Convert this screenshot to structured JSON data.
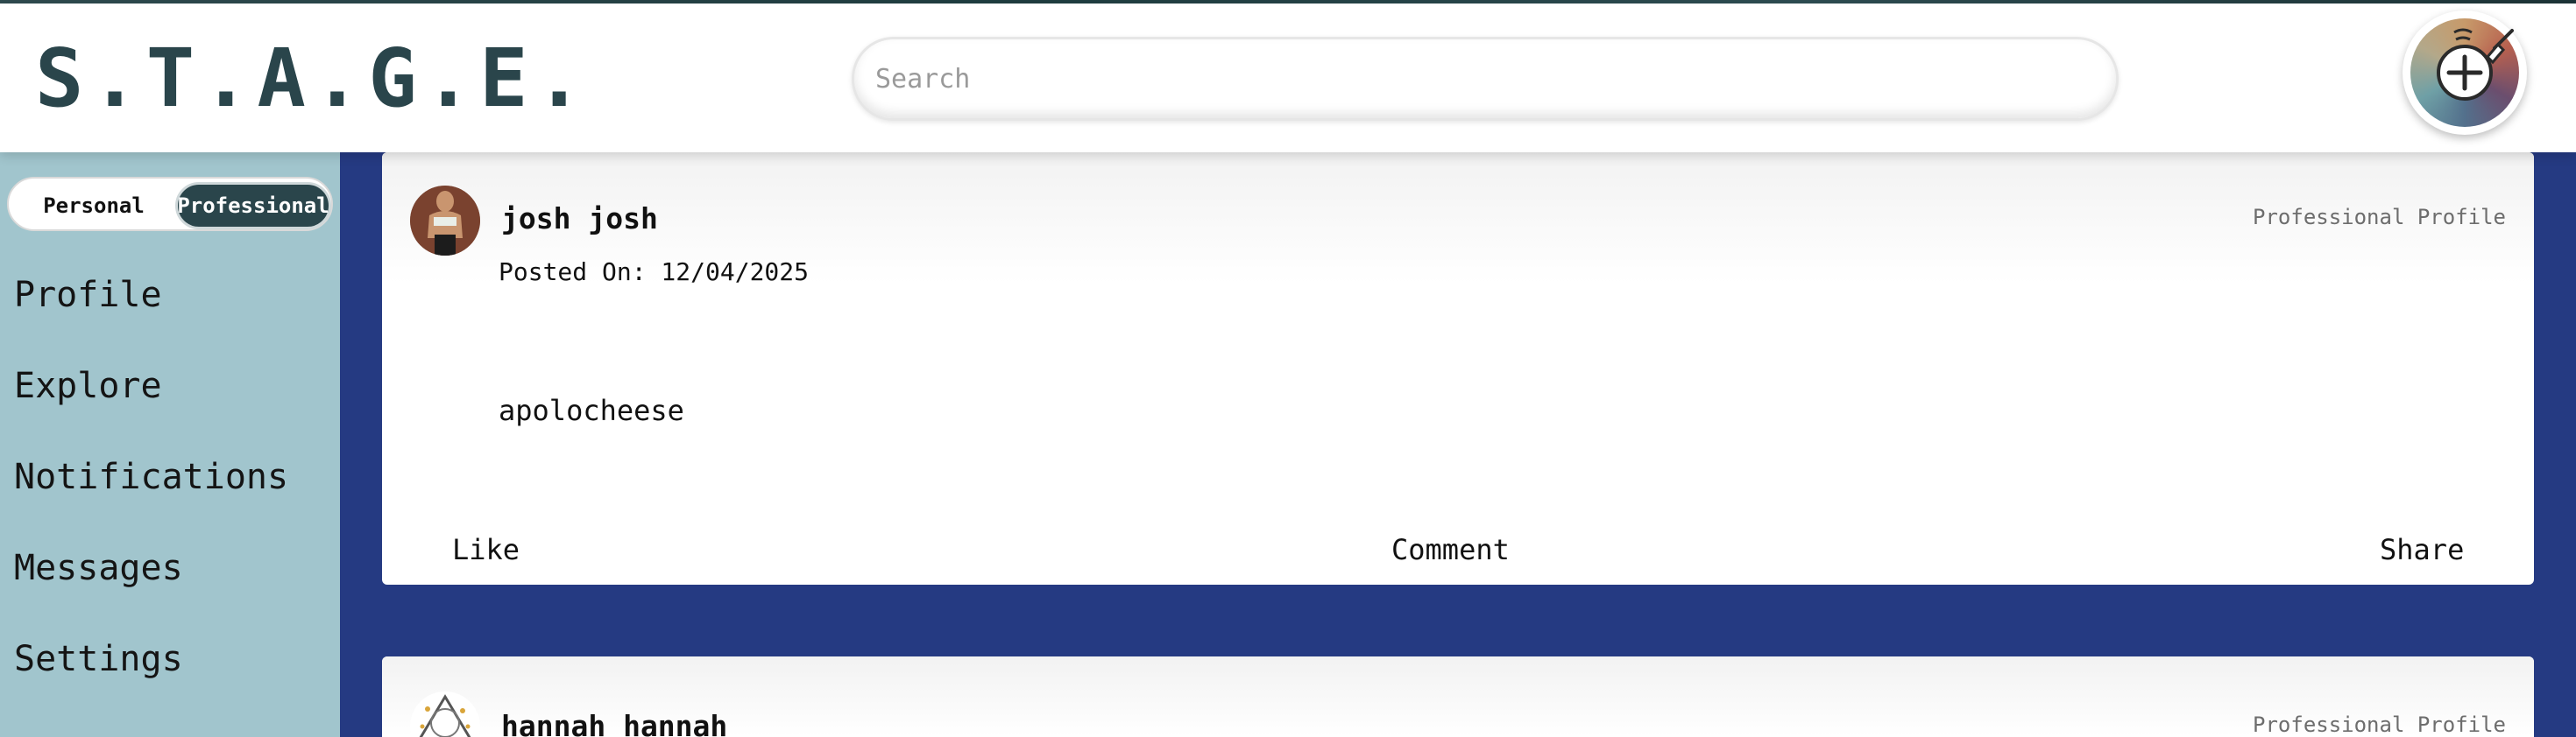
{
  "header": {
    "logo": "S.T.A.G.E.",
    "search_placeholder": "Search",
    "create_icon": "paintbrush-plus-icon"
  },
  "sidebar": {
    "toggle": {
      "options": [
        "Personal",
        "Professional"
      ],
      "selected": "Professional"
    },
    "items": [
      {
        "label": "Profile"
      },
      {
        "label": "Explore"
      },
      {
        "label": "Notifications"
      },
      {
        "label": "Messages"
      },
      {
        "label": "Settings"
      }
    ]
  },
  "feed": {
    "posts": [
      {
        "author": "josh josh",
        "profile_type": "Professional Profile",
        "posted_on": "Posted On: 12/04/2025",
        "body": "apolocheese",
        "actions": {
          "like": "Like",
          "comment": "Comment",
          "share": "Share"
        }
      },
      {
        "author": "hannah hannah",
        "profile_type": "Professional Profile"
      }
    ]
  },
  "colors": {
    "logo": "#2a454b",
    "sidebar_bg": "#a1c5cd",
    "feed_bg": "#253a82",
    "toggle_active": "#2a454b"
  }
}
